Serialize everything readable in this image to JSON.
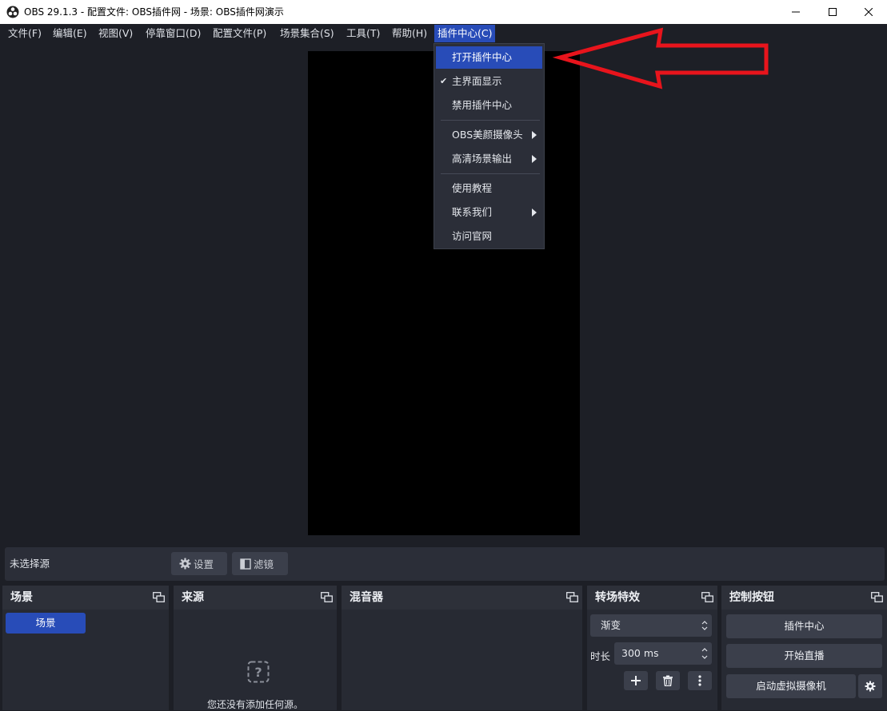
{
  "window": {
    "title": "OBS 29.1.3 - 配置文件: OBS插件网 - 场景: OBS插件网演示"
  },
  "menubar": {
    "items": [
      "文件(F)",
      "编辑(E)",
      "视图(V)",
      "停靠窗口(D)",
      "配置文件(P)",
      "场景集合(S)",
      "工具(T)",
      "帮助(H)",
      "插件中心(C)"
    ],
    "active_index": 8
  },
  "dropdown": {
    "items": [
      {
        "label": "打开插件中心",
        "highlighted": true,
        "checked": false,
        "submenu": false
      },
      {
        "label": "主界面显示",
        "highlighted": false,
        "checked": true,
        "submenu": false
      },
      {
        "label": "禁用插件中心",
        "highlighted": false,
        "checked": false,
        "submenu": false
      },
      {
        "label": "OBS美颜摄像头",
        "highlighted": false,
        "checked": false,
        "submenu": true
      },
      {
        "label": "高清场景输出",
        "highlighted": false,
        "checked": false,
        "submenu": true
      },
      {
        "label": "使用教程",
        "highlighted": false,
        "checked": false,
        "submenu": false
      },
      {
        "label": "联系我们",
        "highlighted": false,
        "checked": false,
        "submenu": true
      },
      {
        "label": "访问官网",
        "highlighted": false,
        "checked": false,
        "submenu": false
      }
    ]
  },
  "source_toolbar": {
    "no_selection": "未选择源",
    "settings": "设置",
    "filters": "滤镜"
  },
  "docks": {
    "scenes": {
      "title": "场景",
      "items": [
        "场景"
      ]
    },
    "sources": {
      "title": "来源",
      "empty_text": "您还没有添加任何源。"
    },
    "mixer": {
      "title": "混音器"
    },
    "transitions": {
      "title": "转场特效",
      "type": "渐变",
      "duration_label": "时长",
      "duration_value": "300 ms"
    },
    "controls": {
      "title": "控制按钮",
      "buttons": [
        "插件中心",
        "开始直播",
        "启动虚拟摄像机"
      ]
    }
  },
  "colors": {
    "accent": "#284cb8",
    "annotation": "#e8141c",
    "background": "#1d1f26"
  },
  "icons": [
    "obs-logo-icon",
    "minimize-icon",
    "maximize-icon",
    "close-icon",
    "checkmark-icon",
    "submenu-arrow-icon",
    "gear-icon",
    "filter-icon",
    "undock-icon",
    "question-icon",
    "plus-icon",
    "trash-icon",
    "more-vertical-icon"
  ]
}
